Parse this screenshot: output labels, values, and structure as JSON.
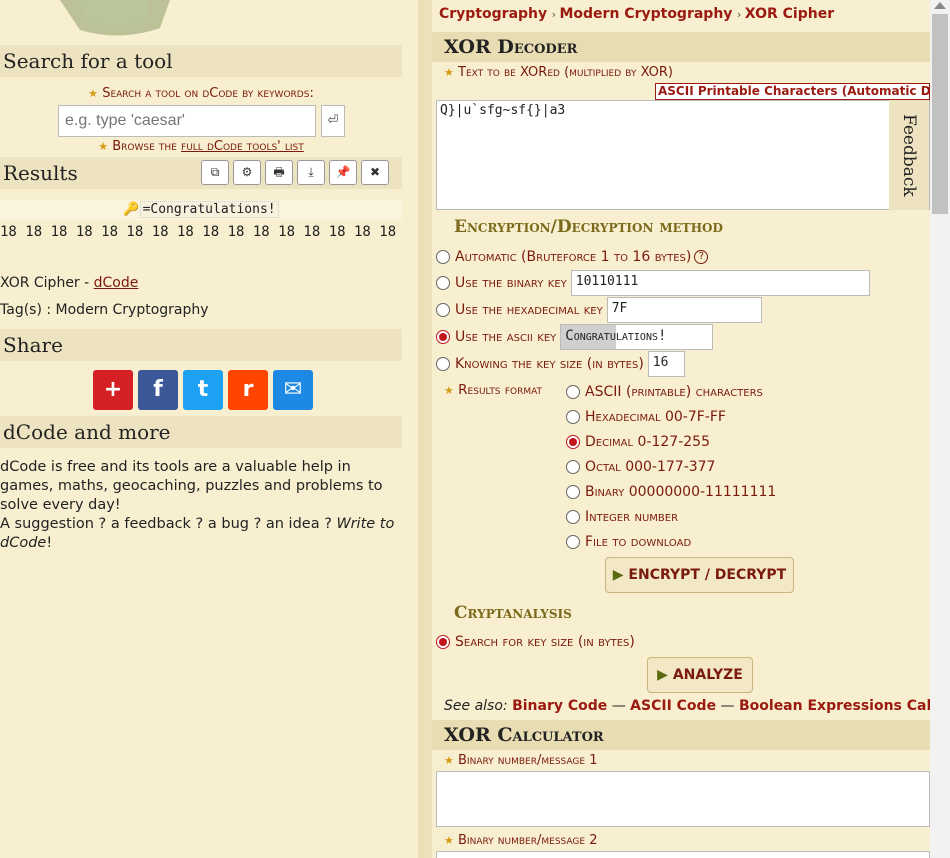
{
  "left": {
    "search_heading": "Search for a tool",
    "search_label": "Search a tool on dCode by keywords:",
    "search_placeholder": "e.g. type 'caesar'",
    "search_button": "⏎",
    "browse_prefix": "Browse the ",
    "browse_link": "full dCode tools' list",
    "results_heading": "Results",
    "result_buttons": [
      "⧉",
      "⚙",
      "🖶",
      "⤓",
      "📌",
      "✖"
    ],
    "result_key": "=Congratulations!",
    "result_values": "18 18 18 18 18 18 18 18 18 18 18 18 18 18 18 18",
    "result_source_prefix": "XOR Cipher - ",
    "result_source_link": "dCode",
    "tags": "Tag(s) : Modern Cryptography",
    "share_heading": "Share",
    "share_icons": [
      {
        "glyph": "+",
        "color": "#d42025",
        "name": "addthis-icon"
      },
      {
        "glyph": "f",
        "color": "#3b5998",
        "name": "facebook-icon"
      },
      {
        "glyph": "t",
        "color": "#1da1f2",
        "name": "twitter-icon"
      },
      {
        "glyph": "r",
        "color": "#ff4500",
        "name": "reddit-icon"
      },
      {
        "glyph": "✉",
        "color": "#1e88e5",
        "name": "email-icon"
      }
    ],
    "more_heading": "dCode and more",
    "more_text": "dCode is free and its tools are a valuable help in games, maths, geocaching, puzzles and problems to solve every day!",
    "more_text2": "A suggestion ? a feedback ? a bug ? an idea ? ",
    "more_link": "Write to dCode",
    "more_end": "!"
  },
  "breadcrumb": [
    "Cryptography",
    "Modern Cryptography",
    "XOR Cipher"
  ],
  "decoder": {
    "heading": "XOR Decoder",
    "text_label": "Text to be XORed (multiplied by XOR)",
    "charset_tag": "ASCII Printable Characters (Automatic Detection)",
    "text_value": "Q}|u`sfg~sf{}|a3",
    "feedback": "Feedback",
    "method_heading": "Encryption/Decryption method",
    "opt_auto": "Automatic (Bruteforce 1 to 16 bytes)",
    "opt_auto_help": "?",
    "opt_binary": "Use the binary key",
    "binary_value": "10110111",
    "opt_hex": "Use the hexadecimal key",
    "hex_value": "7F",
    "opt_ascii": "Use the ascii key",
    "ascii_value": "Congratulations!",
    "opt_size": "Knowing the key size (in bytes)",
    "size_value": "16",
    "format_label": "Results format",
    "formats": [
      "ASCII (printable) characters",
      "Hexadecimal 00-7F-FF",
      "Decimal 0-127-255",
      "Octal 000-177-377",
      "Binary 00000000-11111111",
      "Integer number",
      "File to download"
    ],
    "format_selected": 2,
    "encrypt_button": "ENCRYPT / DECRYPT",
    "cryptanalysis_heading": "Cryptanalysis",
    "search_keysize": "Search for key size (in bytes)",
    "analyze_button": "ANALYZE",
    "see_also_label": "See also: ",
    "see_also": [
      "Binary Code",
      "ASCII Code",
      "Boolean Expressions Calculator"
    ]
  },
  "calculator": {
    "heading": "XOR Calculator",
    "label1": "Binary number/message 1",
    "label2": "Binary number/message 2"
  }
}
